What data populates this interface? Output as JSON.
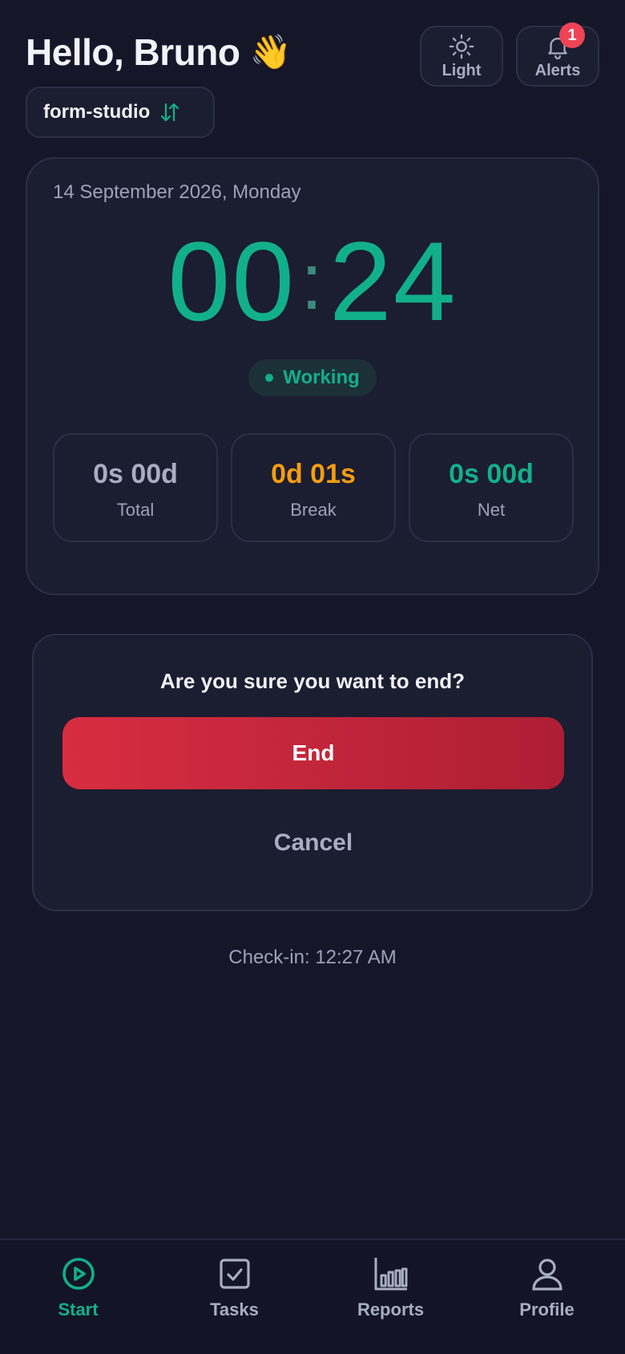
{
  "header": {
    "greeting": "Hello, Bruno",
    "wave_emoji": "👋",
    "light_label": "Light",
    "alerts_label": "Alerts",
    "alerts_count": "1"
  },
  "workspace": {
    "name": "form-studio",
    "switch_icon": "swap-vertical-icon"
  },
  "timer": {
    "date": "14 September 2026, Monday",
    "hours": "00",
    "separator": ":",
    "minutes": "24",
    "status": "Working"
  },
  "stats": {
    "total_value": "0s 00d",
    "total_label": "Total",
    "break_value": "0d 01s",
    "break_label": "Break",
    "net_value": "0s 00d",
    "net_label": "Net"
  },
  "confirm": {
    "question": "Are you sure you want to end?",
    "end_label": "End",
    "cancel_label": "Cancel"
  },
  "checkin": "Check-in: 12:27 AM",
  "nav": {
    "start": "Start",
    "tasks": "Tasks",
    "reports": "Reports",
    "profile": "Profile",
    "active": "start"
  },
  "colors": {
    "background": "#151729",
    "accent_green": "#12b08a",
    "break_orange": "#f59d10",
    "danger_red": "#d82d41",
    "badge_red": "#ef4455"
  }
}
